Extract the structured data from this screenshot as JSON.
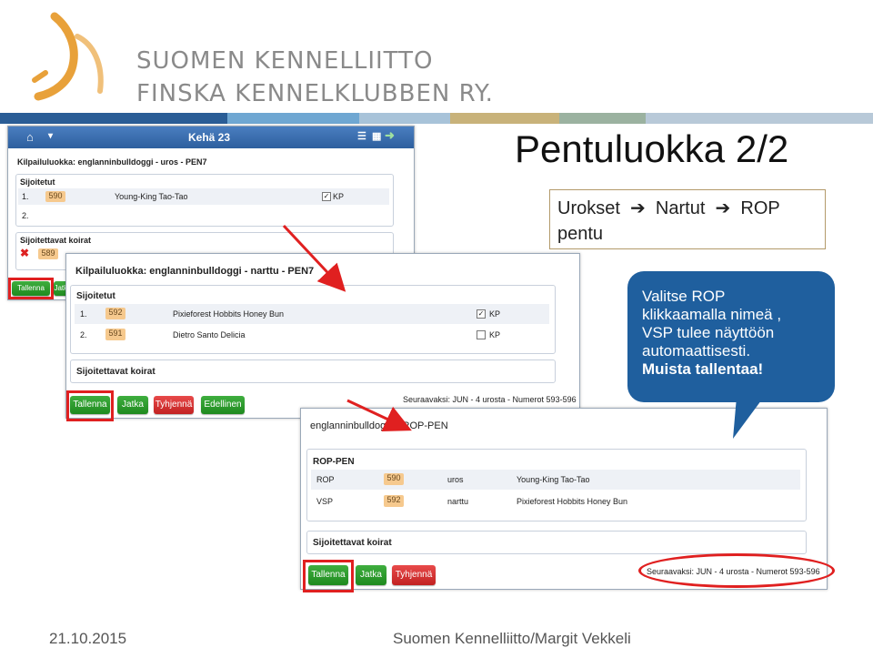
{
  "org": {
    "line1": "SUOMEN KENNELLIITTO",
    "line2": "FINSKA KENNELKLUBBEN RY."
  },
  "colors": {
    "bar": [
      "#2a5d96",
      "#6fa7d2",
      "#a8c3d9",
      "#c8b27a",
      "#9bb2a0",
      "#b8c9d8"
    ],
    "accent": "#1f5f9e",
    "highlight": "#e02020"
  },
  "slide": {
    "title": "Pentuluokka 2/2",
    "flow": {
      "a": "Urokset",
      "b": "Nartut",
      "c": "ROP",
      "d": "pentu"
    },
    "callout": {
      "l1": "Valitse ROP",
      "l2": "klikkaamalla nimeä ,",
      "l3": "VSP tulee näyttöön",
      "l4": "automaattisesti.",
      "l5": "Muista tallentaa!"
    },
    "footer_date": "21.10.2015",
    "footer_author": "Suomen Kennelliitto/Margit Vekkeli"
  },
  "s1": {
    "title": "Kehä 23",
    "class": "Kilpailuluokka: englanninbulldoggi - uros - PEN7",
    "placed_header": "Sijoitetut",
    "rows": [
      {
        "pos": "1.",
        "num": "590",
        "name": "Young-King Tao-Tao",
        "kp": "KP"
      },
      {
        "pos": "2."
      }
    ],
    "toplace_header": "Sijoitettavat koirat",
    "toplace_num": "589",
    "save": "Tallenna",
    "cont": "Jatka"
  },
  "s2": {
    "class": "Kilpailuluokka: englanninbulldoggi - narttu - PEN7",
    "placed_header": "Sijoitetut",
    "rows": [
      {
        "pos": "1.",
        "num": "592",
        "name": "Pixieforest Hobbits Honey Bun",
        "kp": "KP",
        "checked": "✓"
      },
      {
        "pos": "2.",
        "num": "591",
        "name": "Dietro Santo Delicia",
        "kp": "KP",
        "checked": ""
      }
    ],
    "toplace_header": "Sijoitettavat koirat",
    "buttons": {
      "save": "Tallenna",
      "cont": "Jatka",
      "clear": "Tyhjennä",
      "prev": "Edellinen"
    },
    "next": "Seuraavaksi: JUN - 4 urosta - Numerot 593-596"
  },
  "s3": {
    "title": "englanninbulldoggi - ROP-PEN",
    "sec_header": "ROP-PEN",
    "rows": [
      {
        "award": "ROP",
        "num": "590",
        "sex": "uros",
        "name": "Young-King Tao-Tao"
      },
      {
        "award": "VSP",
        "num": "592",
        "sex": "narttu",
        "name": "Pixieforest Hobbits Honey Bun"
      }
    ],
    "toplace_header": "Sijoitettavat koirat",
    "buttons": {
      "save": "Tallenna",
      "cont": "Jatka",
      "clear": "Tyhjennä"
    },
    "next": "Seuraavaksi: JUN - 4 urosta - Numerot 593-596"
  }
}
